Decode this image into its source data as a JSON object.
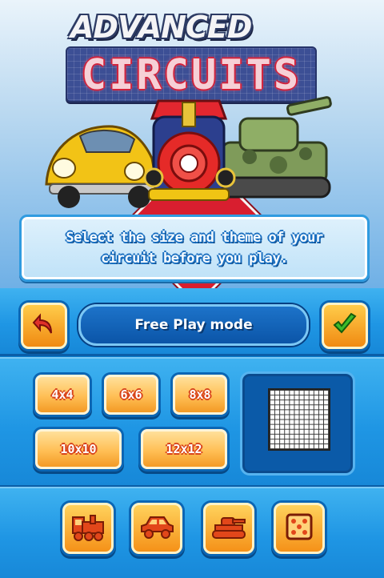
{
  "title": {
    "line1": "ADVANCED",
    "line2": "CIRCUITS"
  },
  "hero": {
    "vehicles": [
      "car",
      "train",
      "tank"
    ]
  },
  "message": "Select the size and theme of your circuit before you play.",
  "toolbar": {
    "back_icon": "back-arrow-icon",
    "confirm_icon": "checkmark-icon",
    "mode_label": "Free Play mode"
  },
  "sizes": [
    "4x4",
    "6x6",
    "8x8",
    "10x10",
    "12x12"
  ],
  "preview": {
    "grid": "12x12"
  },
  "themes": [
    "train-icon",
    "car-icon",
    "tank-icon",
    "dice-icon"
  ],
  "colors": {
    "accent_orange": "#f59118",
    "panel_blue": "#1f96e4",
    "title_red": "#d2233c"
  }
}
